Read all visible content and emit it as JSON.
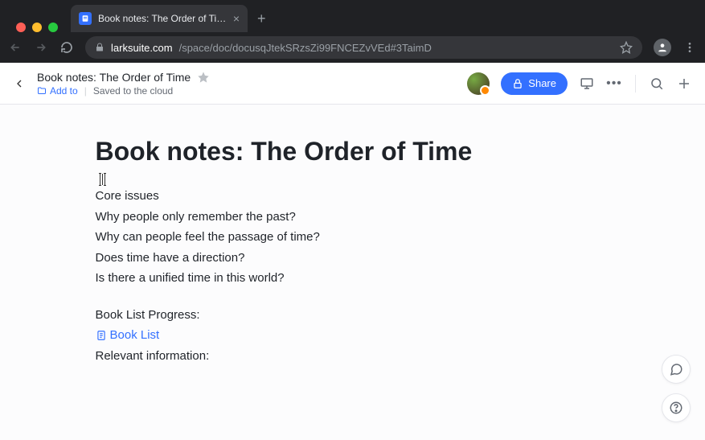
{
  "browser": {
    "tab_title": "Book notes: The Order of Time",
    "url_domain": "larksuite.com",
    "url_path": "/space/doc/docusqJtekSRzsZi99FNCEZvVEd#3TaimD"
  },
  "header": {
    "doc_title": "Book notes: The Order of Time",
    "add_to_label": "Add to",
    "save_status": "Saved to the cloud",
    "share_label": "Share"
  },
  "document": {
    "title": "Book notes: The Order of Time",
    "lines": {
      "l0": "Core issues",
      "l1": "Why people only remember the past?",
      "l2": "Why can people feel the passage of time?",
      "l3": "Does time have a direction?",
      "l4": "Is there a unified time in this world?",
      "l5": "Book List Progress:",
      "link_label": "Book List",
      "l6": "Relevant information:"
    }
  },
  "colors": {
    "accent": "#3370ff"
  }
}
